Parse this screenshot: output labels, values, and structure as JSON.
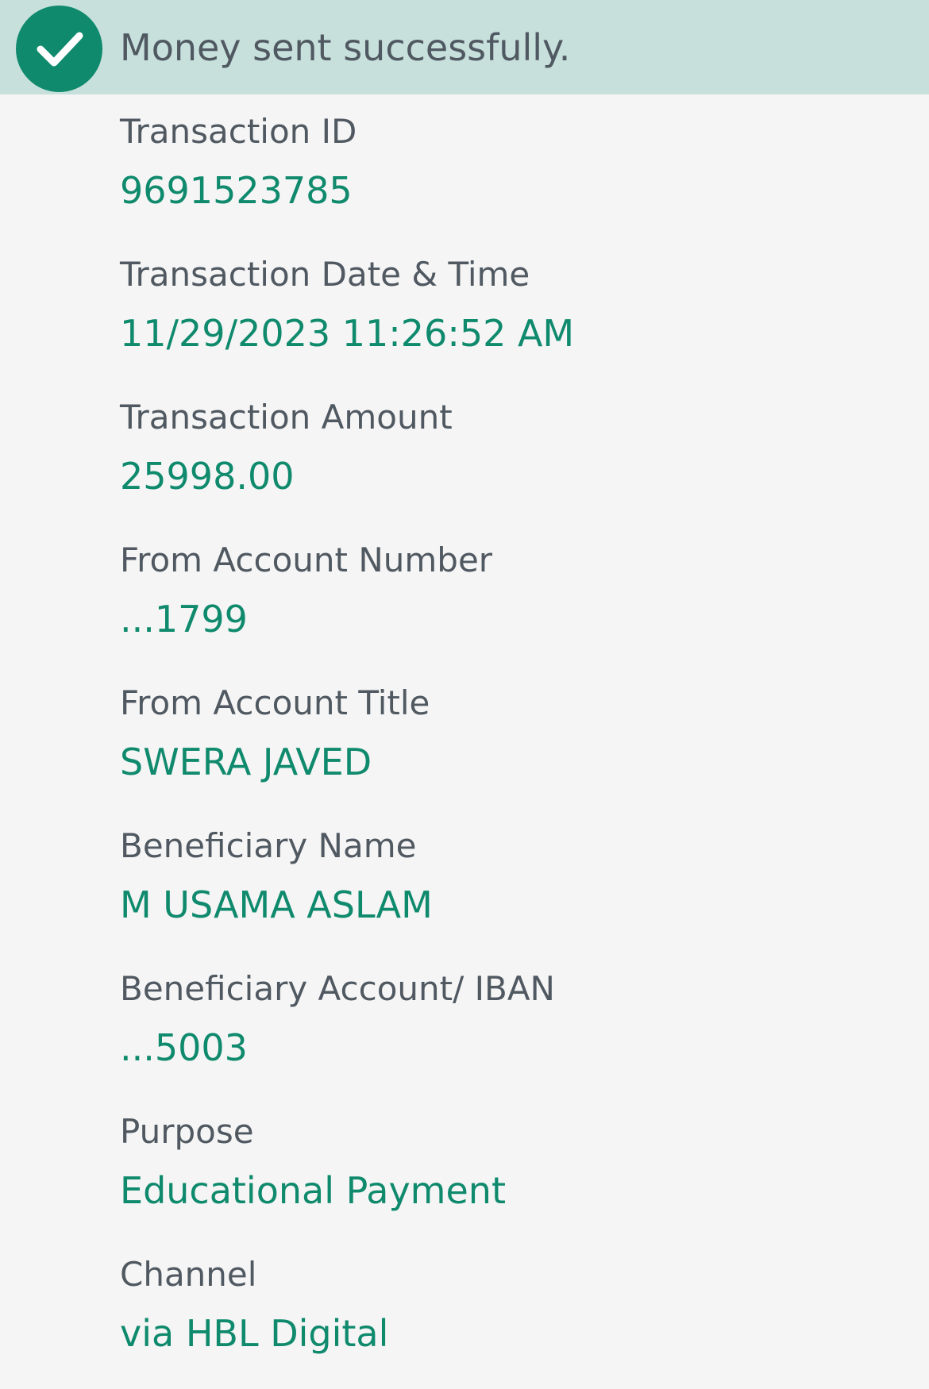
{
  "banner": {
    "message": "Money sent successfully.",
    "icon": "check-circle-icon",
    "background_color": "#c7e0dc",
    "icon_color": "#0f8a6d"
  },
  "colors": {
    "label": "#505961",
    "value": "#0f8a6d",
    "page_background": "#f5f5f5"
  },
  "details": [
    {
      "label": "Transaction ID",
      "value": "9691523785"
    },
    {
      "label": "Transaction Date & Time",
      "value": "11/29/2023 11:26:52 AM"
    },
    {
      "label": "Transaction Amount",
      "value": "25998.00"
    },
    {
      "label": "From Account Number",
      "value": "...1799"
    },
    {
      "label": "From Account Title",
      "value": "SWERA JAVED"
    },
    {
      "label": "Beneficiary Name",
      "value": "M USAMA ASLAM"
    },
    {
      "label": "Beneficiary Account/ IBAN",
      "value": "...5003"
    },
    {
      "label": "Purpose",
      "value": "Educational Payment"
    },
    {
      "label": "Channel",
      "value": "via HBL Digital"
    }
  ]
}
